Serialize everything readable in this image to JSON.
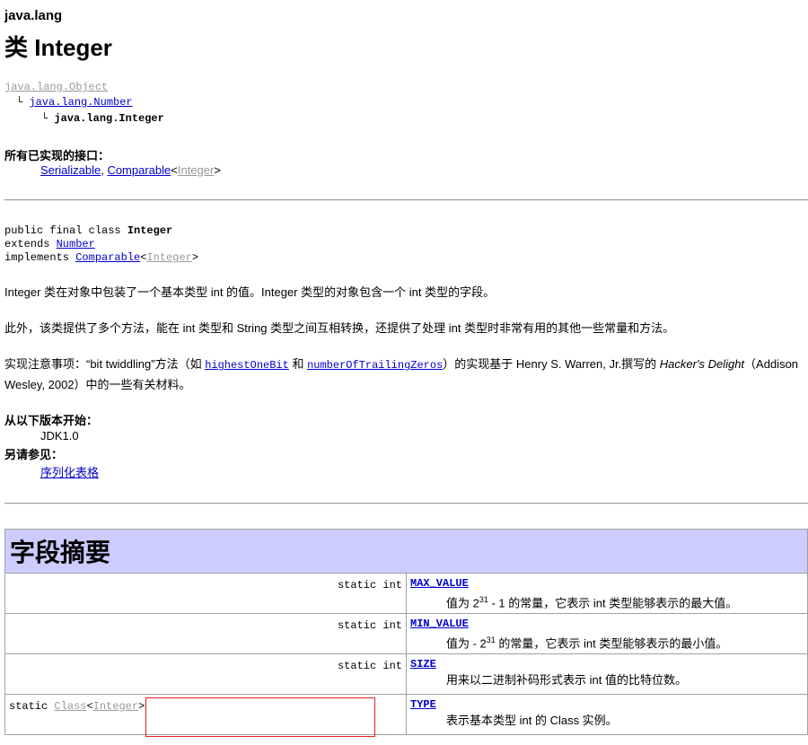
{
  "header": {
    "package": "java.lang",
    "class_title": "类 Integer"
  },
  "hierarchy": {
    "root": "java.lang.Object",
    "parent": "java.lang.Number",
    "current": "java.lang.Integer",
    "branch": "└"
  },
  "interfaces": {
    "label": "所有已实现的接口：",
    "items": [
      "Serializable",
      "Comparable"
    ],
    "generic_param": "Integer",
    "sep": ", ",
    "lt": "<",
    "gt": ">"
  },
  "declaration": {
    "line1_prefix": "public final class ",
    "line1_name": "Integer",
    "extends_kw": "extends ",
    "extends_name": "Number",
    "implements_kw": "implements ",
    "implements_name": "Comparable",
    "implements_param": "Integer"
  },
  "description": {
    "p1": "Integer 类在对象中包装了一个基本类型 int 的值。Integer 类型的对象包含一个 int 类型的字段。",
    "p2": "此外，该类提供了多个方法，能在 int 类型和 String 类型之间互相转换，还提供了处理 int 类型时非常有用的其他一些常量和方法。",
    "p3_a": "实现注意事项：“bit twiddling”方法（如 ",
    "p3_link1": "highestOneBit",
    "p3_b": " 和 ",
    "p3_link2": "numberOfTrailingZeros",
    "p3_c": "）的实现基于 Henry S. Warren, Jr.撰写的 ",
    "p3_italic": "Hacker's Delight",
    "p3_d": "（Addison Wesley, 2002）中的一些有关材料。"
  },
  "since": {
    "label": "从以下版本开始：",
    "value": "JDK1.0"
  },
  "see_also": {
    "label": "另请参见：",
    "link": "序列化表格"
  },
  "field_summary": {
    "heading": "字段摘要",
    "rows": [
      {
        "modifier": "static int",
        "name": "MAX_VALUE",
        "desc_pre": "值为 2",
        "desc_sup": "31",
        "desc_post": " - 1 的常量，它表示 int 类型能够表示的最大值。"
      },
      {
        "modifier": "static int",
        "name": "MIN_VALUE",
        "desc_pre": "值为  - 2",
        "desc_sup": "31",
        "desc_post": " 的常量，它表示 int 类型能够表示的最小值。"
      },
      {
        "modifier": "static int",
        "name": "SIZE",
        "desc": "用来以二进制补码形式表示 int 值的比特位数。"
      },
      {
        "modifier_prefix": "static ",
        "modifier_class": "Class",
        "modifier_param": "Integer",
        "name": "TYPE",
        "desc": "表示基本类型 int 的 Class 实例。"
      }
    ]
  }
}
